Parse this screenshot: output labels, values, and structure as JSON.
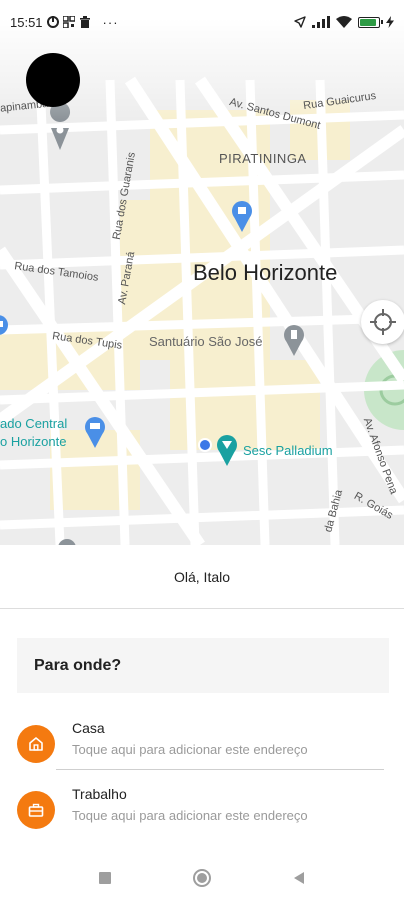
{
  "status_bar": {
    "time": "15:51",
    "left_icons": [
      "data-saver-icon",
      "qr-icon",
      "trash-icon",
      "more-dots-icon"
    ],
    "right_icons": [
      "navigation-arrow-icon",
      "signal-icon",
      "wifi-icon",
      "battery-icon",
      "charging-icon"
    ],
    "battery_level": 0.8,
    "battery_color": "#2e9b45"
  },
  "map": {
    "city": "Belo Horizonte",
    "district": "PIRATININGA",
    "pois": {
      "santuario": "Santuário São José",
      "sesc": "Sesc Palladium",
      "mercado_line1": "ado Central",
      "mercado_line2": "o Horizonte",
      "top_left": "apinambás"
    },
    "streets": {
      "guaicurus": "Rua Guaicurus",
      "santos_dumont": "Av. Santos Dumont",
      "guaranis": "Rua dos Guaranis",
      "tamoios": "Rua dos Tamoios",
      "parana": "Av. Paraná",
      "tupis": "Rua dos Tupis",
      "afonso_pena": "Av. Afonso Pena",
      "bahia": "da Bahia",
      "goias": "R. Goiás"
    },
    "colors": {
      "background": "#ededed",
      "block_highlight": "#f7efcf",
      "park": "#c8e6c9",
      "poi_blue": "#4a8fe7",
      "poi_teal": "#1aa1a1",
      "pin_gray": "#8c9399",
      "user_dot": "#3b78e7"
    }
  },
  "sheet": {
    "greeting": "Olá, Italo",
    "search_label": "Para onde?",
    "places": [
      {
        "title": "Casa",
        "subtitle": "Toque aqui para adicionar este endereço",
        "icon": "home-icon"
      },
      {
        "title": "Trabalho",
        "subtitle": "Toque aqui para adicionar este endereço",
        "icon": "briefcase-icon"
      }
    ],
    "accent": "#f47a10"
  },
  "nav_bar": {
    "icons": [
      "recents-square-icon",
      "home-circle-icon",
      "back-triangle-icon"
    ]
  }
}
